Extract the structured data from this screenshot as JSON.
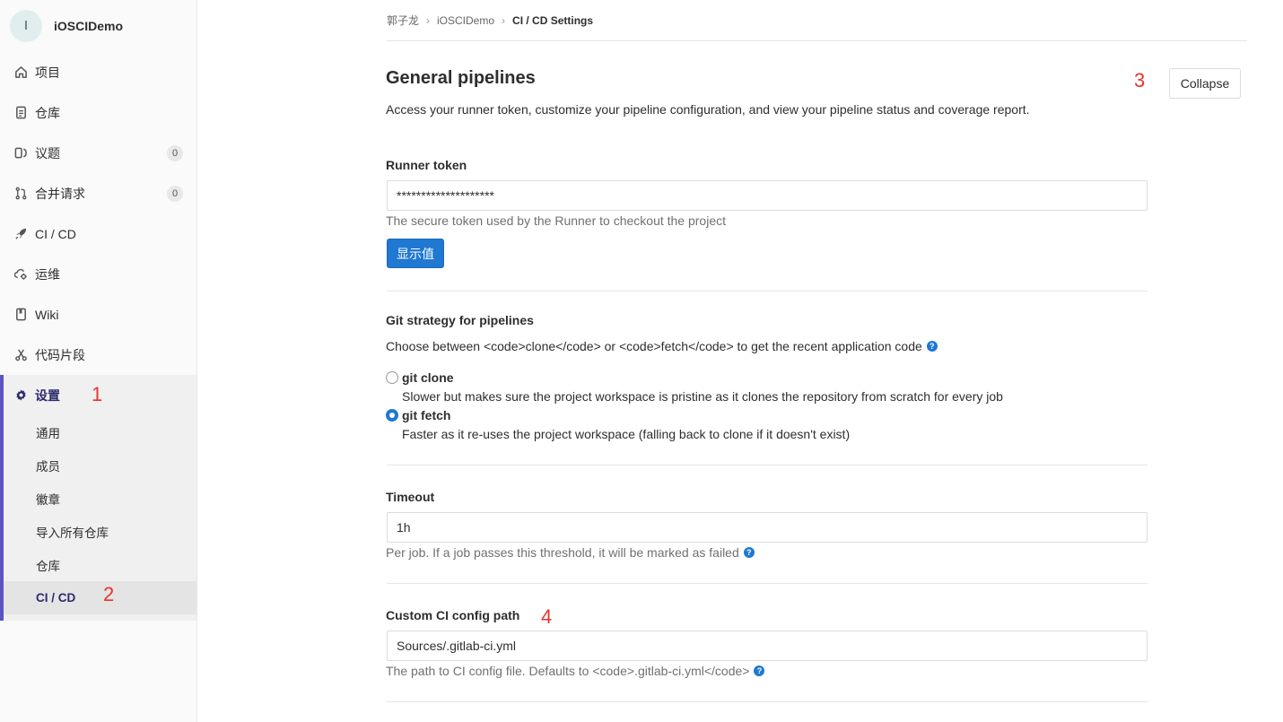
{
  "project": {
    "avatar_letter": "I",
    "name": "iOSCIDemo"
  },
  "sidebar": {
    "items": [
      {
        "label": "项目",
        "icon": "home-icon"
      },
      {
        "label": "仓库",
        "icon": "document-icon"
      },
      {
        "label": "议题",
        "icon": "issues-icon",
        "badge": "0"
      },
      {
        "label": "合并请求",
        "icon": "merge-request-icon",
        "badge": "0"
      },
      {
        "label": "CI / CD",
        "icon": "rocket-icon"
      },
      {
        "label": "运维",
        "icon": "cloud-gear-icon"
      },
      {
        "label": "Wiki",
        "icon": "book-icon"
      },
      {
        "label": "代码片段",
        "icon": "scissors-icon"
      },
      {
        "label": "设置",
        "icon": "gear-icon"
      }
    ],
    "settings_sub": [
      "通用",
      "成员",
      "徽章",
      "导入所有仓库",
      "仓库",
      "CI / CD"
    ]
  },
  "annotations": {
    "a1": "1",
    "a2": "2",
    "a3": "3",
    "a4": "4"
  },
  "breadcrumb": [
    "郭子龙",
    "iOSCIDemo",
    "CI / CD Settings"
  ],
  "section": {
    "title": "General pipelines",
    "description": "Access your runner token, customize your pipeline configuration, and view your pipeline status and coverage report.",
    "collapse_label": "Collapse"
  },
  "runner_token": {
    "label": "Runner token",
    "value": "********************",
    "help": "The secure token used by the Runner to checkout the project",
    "reveal_label": "显示值"
  },
  "git_strategy": {
    "label": "Git strategy for pipelines",
    "description": "Choose between <code>clone</code> or <code>fetch</code> to get the recent application code",
    "options": [
      {
        "label": "git clone",
        "help": "Slower but makes sure the project workspace is pristine as it clones the repository from scratch for every job",
        "checked": false
      },
      {
        "label": "git fetch",
        "help": "Faster as it re-uses the project workspace (falling back to clone if it doesn't exist)",
        "checked": true
      }
    ]
  },
  "timeout": {
    "label": "Timeout",
    "value": "1h",
    "help": "Per job. If a job passes this threshold, it will be marked as failed"
  },
  "ci_config": {
    "label": "Custom CI config path",
    "value": "Sources/.gitlab-ci.yml",
    "help": "The path to CI config file. Defaults to <code>.gitlab-ci.yml</code>"
  },
  "colors": {
    "primary": "#1f78d1",
    "accent": "#5a54c4",
    "annotation": "#e8332b"
  }
}
